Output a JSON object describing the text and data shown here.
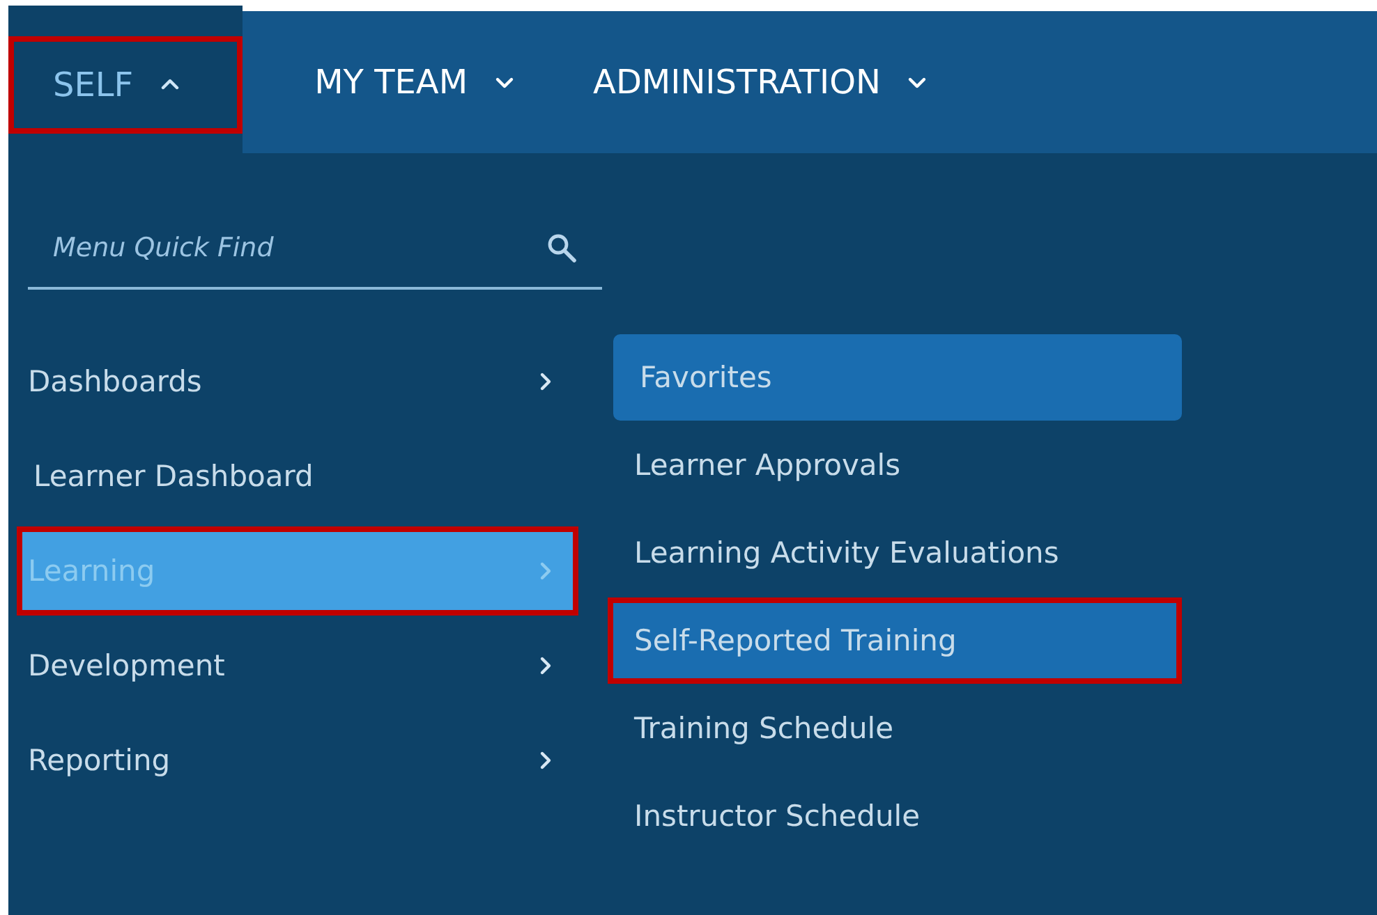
{
  "nav_tabs": [
    {
      "label": "SELF",
      "expanded": true,
      "selected": true,
      "highlighted": true
    },
    {
      "label": "MY TEAM",
      "expanded": false,
      "selected": false,
      "highlighted": false
    },
    {
      "label": "ADMINISTRATION",
      "expanded": false,
      "selected": false,
      "highlighted": false
    }
  ],
  "search": {
    "placeholder": "Menu Quick Find"
  },
  "menu_items": [
    {
      "label": "Dashboards",
      "kind": "submenu",
      "selected": false,
      "highlighted": false
    },
    {
      "label": "Learner Dashboard",
      "kind": "link",
      "selected": false,
      "highlighted": false
    },
    {
      "label": "Learning",
      "kind": "submenu",
      "selected": true,
      "highlighted": true
    },
    {
      "label": "Development",
      "kind": "submenu",
      "selected": false,
      "highlighted": false
    },
    {
      "label": "Reporting",
      "kind": "submenu",
      "selected": false,
      "highlighted": false
    }
  ],
  "submenu_items": [
    {
      "label": "Favorites",
      "kind": "favorites",
      "selected": false,
      "highlighted": false
    },
    {
      "label": "Learner Approvals",
      "kind": "link",
      "selected": false,
      "highlighted": false
    },
    {
      "label": "Learning Activity Evaluations",
      "kind": "link",
      "selected": false,
      "highlighted": false
    },
    {
      "label": "Self-Reported Training",
      "kind": "link",
      "selected": true,
      "highlighted": true
    },
    {
      "label": "Training Schedule",
      "kind": "link",
      "selected": false,
      "highlighted": false
    },
    {
      "label": "Instructor Schedule",
      "kind": "link",
      "selected": false,
      "highlighted": false
    }
  ]
}
